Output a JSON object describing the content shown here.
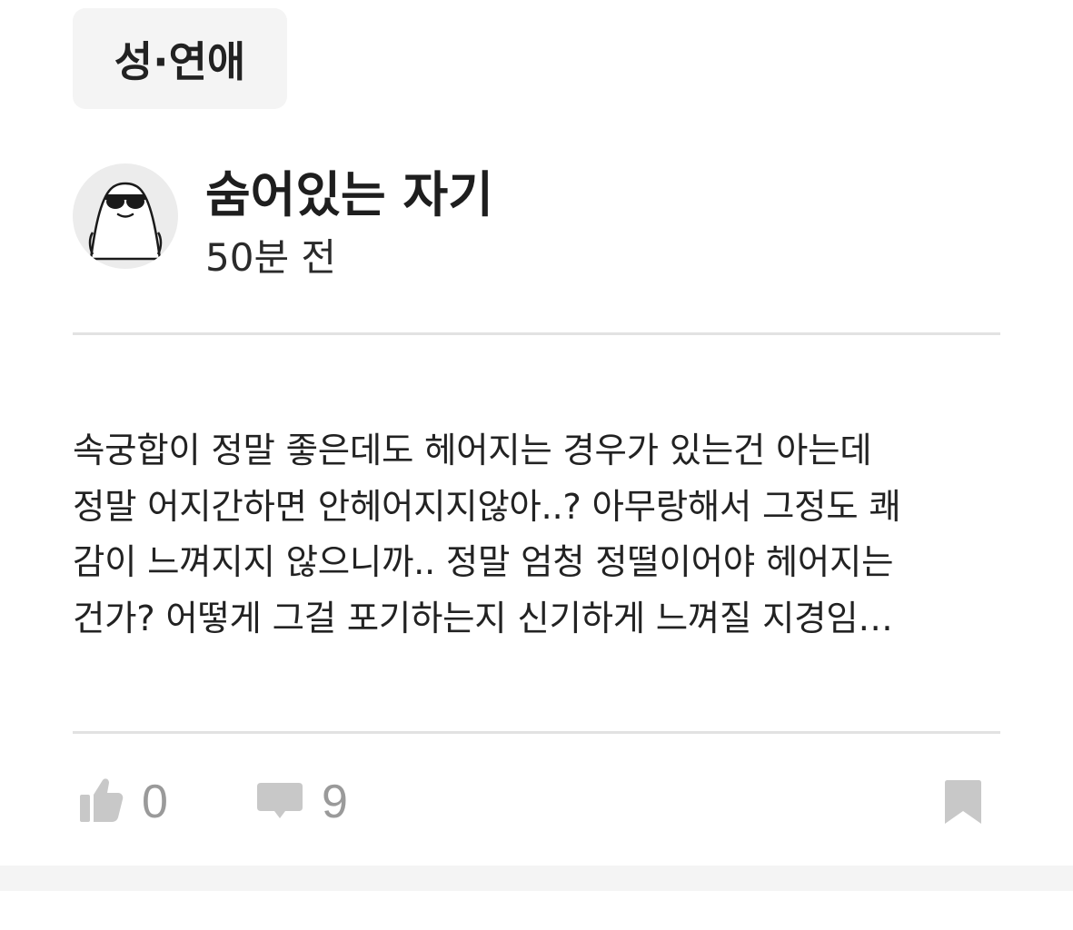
{
  "category": {
    "label": "성·연애"
  },
  "author": {
    "name": "숨어있는 자기",
    "time": "50분 전",
    "avatar_icon": "sunglasses-ghost-avatar-icon"
  },
  "post": {
    "lines": [
      "속궁합이 정말 좋은데도 헤어지는 경우가 있는건 아는데",
      "정말 어지간하면 안헤어지지않아..? 아무랑해서 그정도 쾌",
      "감이 느껴지지 않으니까.. 정말 엄청 정떨이어야 헤어지는",
      "건가? 어떻게 그걸 포기하는지 신기하게 느껴질 지경임…"
    ]
  },
  "actions": {
    "like": {
      "icon": "thumbs-up-icon",
      "count": "0"
    },
    "comment": {
      "icon": "comment-bubble-icon",
      "count": "9"
    },
    "bookmark": {
      "icon": "bookmark-icon"
    }
  },
  "colors": {
    "chip_bg": "#f4f4f4",
    "text": "#222222",
    "icon_gray": "#c8c8c8",
    "count_gray": "#9a9a9a",
    "divider": "#e2e2e2"
  }
}
